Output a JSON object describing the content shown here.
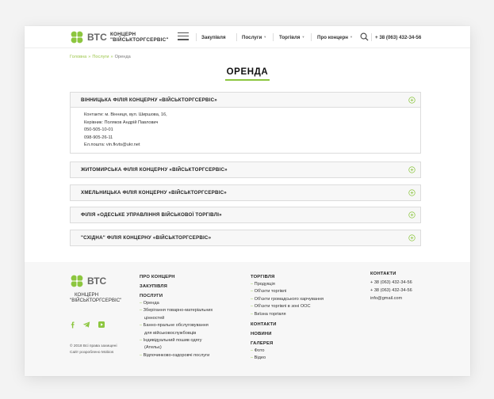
{
  "header": {
    "logo_text": "ВТС",
    "brand_line1": "КОНЦЕРН",
    "brand_line2": "\"ВІЙСЬКТОРГСЕРВІС\"",
    "nav": [
      "Закупівля",
      "Послуги",
      "Торгівля",
      "Про концерн"
    ],
    "phone": "+ 38 (063) 432-34-56"
  },
  "breadcrumb": {
    "home": "Головна",
    "section": "Послуги",
    "sep": "»",
    "current": "Оренда"
  },
  "page_title": "ОРЕНДА",
  "accordion": [
    {
      "title": "ВІННИЦЬКА ФІЛІЯ КОНЦЕРНУ «ВІЙСЬКТОРГСЕРВІС»",
      "open": true,
      "lines": [
        "Контакти: м. Вінниця, вул. Ширшова, 16,",
        "Керівник: Поляков Андрій Павлович",
        "050-505-10-01",
        "098-905-26-11",
        "Ел.пошта: vin.fkvts@ukr.net"
      ]
    },
    {
      "title": "ЖИТОМИРСЬКА ФІЛІЯ КОНЦЕРНУ «ВІЙСЬКТОРГСЕРВІС»",
      "open": false
    },
    {
      "title": "ХМЕЛЬНИЦЬКА ФІЛІЯ КОНЦЕРНУ «ВІЙСЬКТОРГСЕРВІС»",
      "open": false
    },
    {
      "title": "ФІЛІЯ «ОДЕСЬКЕ УПРАВЛІННЯ ВІЙСЬКОВОЇ ТОРГІВЛІ»",
      "open": false
    },
    {
      "title": "\"СХІДНА\" ФІЛІЯ КОНЦЕРНУ «ВІЙСЬКТОРГСЕРВІС»",
      "open": false
    }
  ],
  "footer": {
    "logo_text": "ВТС",
    "brand_line1": "КОНЦЕРН",
    "brand_line2": "\"ВІЙСЬКТОРГСЕРВІС\"",
    "copyright": "© 2018 Всі права захищені",
    "developer": "Сайт розроблено Mobios",
    "col1": {
      "about": "ПРО КОНЦЕРН",
      "procurement": "ЗАКУПІВЛЯ",
      "services": "ПОСЛУГИ",
      "items": [
        "Оренда",
        "Зберігання товарно-матеріальних",
        "цінностей",
        "Банно-пральне обслуговування",
        "для військовослужбовців",
        "Індивідуальний пошив одягу",
        "(Ательє)",
        "Відпочинково-оздоровчі послуги"
      ]
    },
    "col2": {
      "trade": "ТОРГІВЛЯ",
      "trade_items": [
        "Продукція",
        "Об'єкти торгівлі",
        "Об'єкти громадського харчування",
        "Об'єкти торгівлі в зоні ООС",
        "Виїзна торгівля"
      ],
      "contacts": "КОНТАКТИ",
      "news": "НОВИНИ",
      "gallery": "ГАЛЕРЕЯ",
      "gallery_items": [
        "Фото",
        "Відео"
      ]
    },
    "col3": {
      "contacts": "КОНТАКТИ",
      "phone1": "+ 38 (063) 432-34-56",
      "phone2": "+ 38 (063) 432-34-56",
      "email": "info@gmail.com"
    }
  },
  "colors": {
    "accent": "#8cc63f",
    "breadcrumb_link": "#9cc54a"
  },
  "icons": {
    "menu": "hamburger-icon",
    "search": "search-icon",
    "expand": "plus-circle-icon",
    "social": [
      "facebook-icon",
      "telegram-icon",
      "youtube-icon"
    ]
  }
}
